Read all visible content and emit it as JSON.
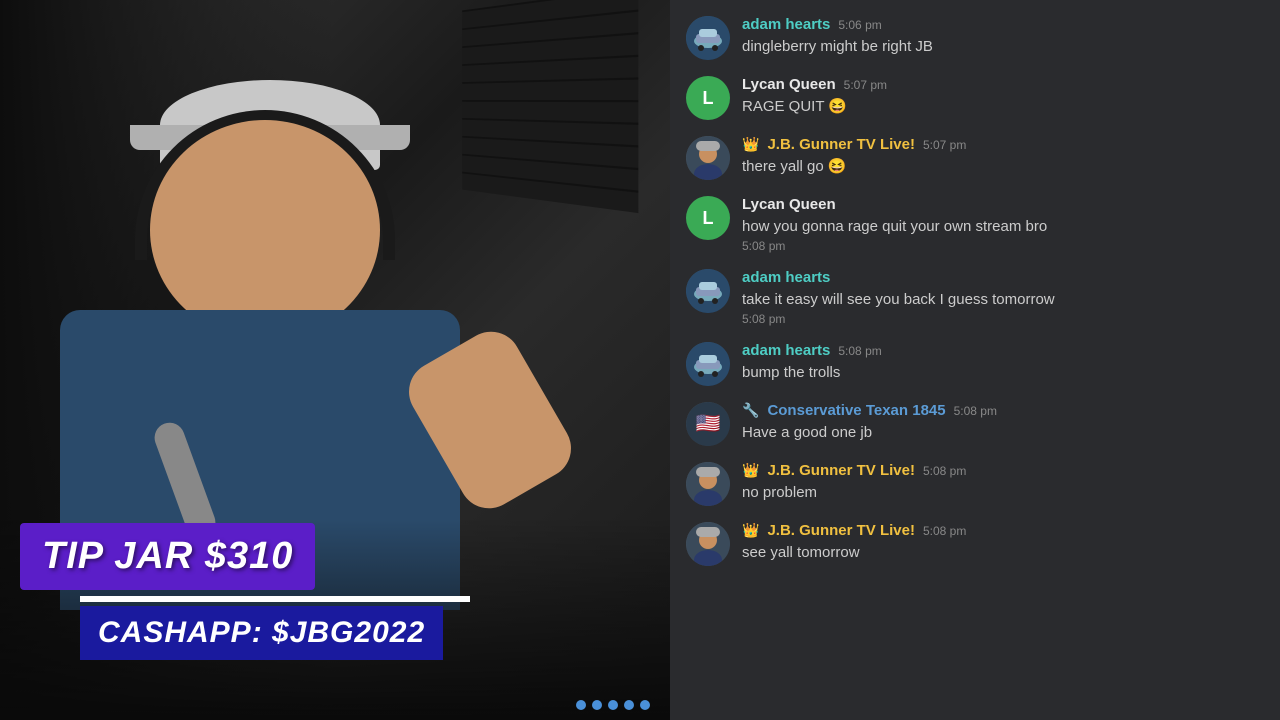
{
  "video": {
    "tip_jar_label": "TIP JAR $310",
    "cashapp_label": "CASHAPP: $JBG2022"
  },
  "chat": {
    "messages": [
      {
        "id": "msg1",
        "avatar_type": "car",
        "username": "adam hearts",
        "username_color": "teal",
        "badge": null,
        "text": "dingleberry might be right JB",
        "timestamp": "5:06 pm"
      },
      {
        "id": "msg2",
        "avatar_type": "L",
        "username": "Lycan Queen",
        "username_color": "white",
        "badge": null,
        "text": "RAGE QUIT 😆",
        "timestamp": "5:07 pm"
      },
      {
        "id": "msg3",
        "avatar_type": "jb",
        "username": "J.B. Gunner TV Live!",
        "username_color": "yellow",
        "badge": "crown",
        "text": "there yall go 😆",
        "timestamp": "5:07 pm"
      },
      {
        "id": "msg4",
        "avatar_type": "L",
        "username": "Lycan Queen",
        "username_color": "white",
        "badge": null,
        "text": "how you gonna rage quit your own stream bro",
        "timestamp": "5:08 pm",
        "timestamp_below": true
      },
      {
        "id": "msg5",
        "avatar_type": "car",
        "username": "adam hearts",
        "username_color": "teal",
        "badge": null,
        "text": "take it easy will see you back I guess tomorrow",
        "timestamp": "5:08 pm",
        "timestamp_below": true
      },
      {
        "id": "msg6",
        "avatar_type": "car",
        "username": "adam hearts",
        "username_color": "teal",
        "badge": null,
        "text": "bump the trolls",
        "timestamp": "5:08 pm"
      },
      {
        "id": "msg7",
        "avatar_type": "ct",
        "username": "Conservative Texan 1845",
        "username_color": "blue",
        "badge": "wrench",
        "text": "Have a good one jb",
        "timestamp": "5:08 pm"
      },
      {
        "id": "msg8",
        "avatar_type": "jb",
        "username": "J.B. Gunner TV Live!",
        "username_color": "yellow",
        "badge": "crown",
        "text": "no problem",
        "timestamp": "5:08 pm"
      },
      {
        "id": "msg9",
        "avatar_type": "jb",
        "username": "J.B. Gunner TV Live!",
        "username_color": "yellow",
        "badge": "crown",
        "text": "see yall tomorrow",
        "timestamp": "5:08 pm"
      }
    ]
  }
}
